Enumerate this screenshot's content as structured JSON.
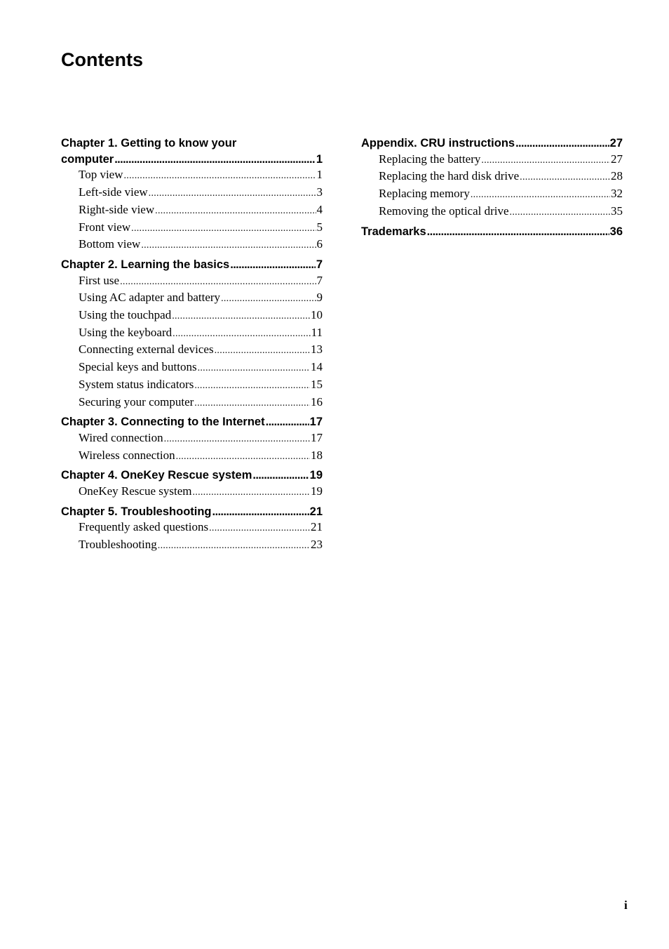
{
  "page": {
    "title": "Contents",
    "page_number": "i"
  },
  "toc": {
    "left": [
      {
        "title_line1": "Chapter 1. Getting to know your",
        "title": "computer",
        "page": "1",
        "items": [
          {
            "label": "Top view",
            "page": "1"
          },
          {
            "label": "Left-side view",
            "page": "3"
          },
          {
            "label": "Right-side view",
            "page": "4"
          },
          {
            "label": "Front view",
            "page": "5"
          },
          {
            "label": "Bottom view",
            "page": "6"
          }
        ]
      },
      {
        "title": "Chapter 2. Learning the basics",
        "page": "7",
        "items": [
          {
            "label": "First use",
            "page": "7"
          },
          {
            "label": "Using AC adapter and battery",
            "page": "9"
          },
          {
            "label": "Using the touchpad",
            "page": "10"
          },
          {
            "label": "Using the keyboard",
            "page": "11"
          },
          {
            "label": "Connecting external devices",
            "page": "13"
          },
          {
            "label": "Special keys and buttons",
            "page": "14"
          },
          {
            "label": "System status indicators",
            "page": "15"
          },
          {
            "label": "Securing your computer",
            "page": "16"
          }
        ]
      },
      {
        "title": "Chapter 3. Connecting to the Internet",
        "page": "17",
        "items": [
          {
            "label": "Wired connection",
            "page": "17"
          },
          {
            "label": "Wireless connection",
            "page": "18"
          }
        ]
      },
      {
        "title": "Chapter 4. OneKey Rescue system",
        "page": "19",
        "items": [
          {
            "label": "OneKey Rescue system",
            "page": "19"
          }
        ]
      },
      {
        "title": "Chapter 5. Troubleshooting",
        "page": "21",
        "items": [
          {
            "label": "Frequently asked questions",
            "page": "21"
          },
          {
            "label": "Troubleshooting",
            "page": "23"
          }
        ]
      }
    ],
    "right": [
      {
        "title": "Appendix. CRU instructions",
        "page": "27",
        "items": [
          {
            "label": "Replacing the battery",
            "page": "27"
          },
          {
            "label": "Replacing the hard disk drive",
            "page": "28"
          },
          {
            "label": "Replacing memory",
            "page": "32"
          },
          {
            "label": "Removing the optical drive",
            "page": "35"
          }
        ]
      },
      {
        "title": "Trademarks",
        "page": "36",
        "items": []
      }
    ]
  }
}
